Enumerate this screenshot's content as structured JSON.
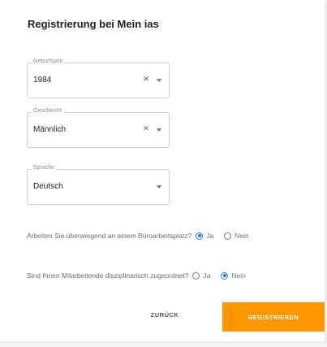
{
  "title": "Registrierung bei Mein ias",
  "fields": {
    "birthyear": {
      "label": "Geburtsjahr",
      "value": "1984",
      "clear_icon": "×"
    },
    "gender": {
      "label": "Geschlecht",
      "value": "Männlich",
      "clear_icon": "×"
    },
    "language": {
      "label": "Sprache",
      "value": "Deutsch"
    }
  },
  "questions": {
    "office": {
      "text": "Arbeiten Sie überwiegend an einem Büroarbeitsplatz?",
      "yes_label": "Ja",
      "no_label": "Nein",
      "selected": "Ja"
    },
    "manager": {
      "text": "Sind Ihnen Mitarbeitende disziplinarisch zugeordnet?",
      "yes_label": "Ja",
      "no_label": "Nein",
      "selected": "Nein"
    }
  },
  "actions": {
    "back_label": "ZURÜCK",
    "register_label": "REGISTRIEREN"
  },
  "colors": {
    "accent": "#ff9800",
    "radio_selected": "#1e73e8"
  }
}
